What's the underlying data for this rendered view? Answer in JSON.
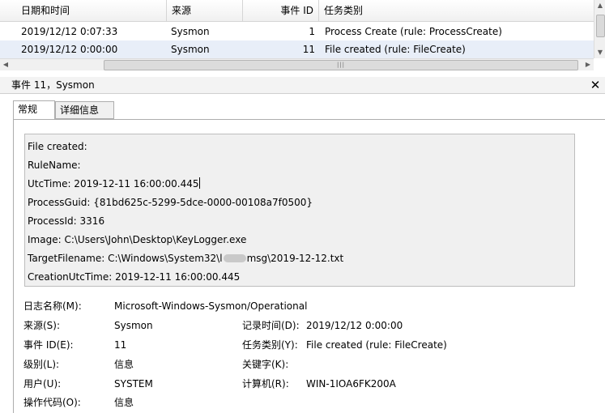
{
  "event_list": {
    "columns": [
      "日期和时间",
      "来源",
      "事件 ID",
      "任务类别"
    ],
    "rows": [
      {
        "date": "2019/12/12 0:07:33",
        "source": "Sysmon",
        "event_id": "1",
        "task": "Process Create (rule: ProcessCreate)"
      },
      {
        "date": "2019/12/12 0:00:00",
        "source": "Sysmon",
        "event_id": "11",
        "task": "File created (rule: FileCreate)"
      }
    ]
  },
  "detail": {
    "title": "事件 11，Sysmon",
    "close_label": "✕",
    "tabs": [
      "常规",
      "详细信息"
    ],
    "message": {
      "line1": "File created:",
      "line2": "RuleName:",
      "line3": "UtcTime: 2019-12-11 16:00:00.445",
      "line4": "ProcessGuid: {81bd625c-5299-5dce-0000-00108a7f0500}",
      "line5": "ProcessId: 3316",
      "line6": "Image: C:\\Users\\John\\Desktop\\KeyLogger.exe",
      "line7_prefix": "TargetFilename: C:\\Windows\\System32\\l",
      "line7_suffix": "msg\\2019-12-12.txt",
      "line8": "CreationUtcTime: 2019-12-11 16:00:00.445"
    },
    "properties": {
      "log_name_label": "日志名称(M):",
      "log_name": "Microsoft-Windows-Sysmon/Operational",
      "source_label": "来源(S):",
      "source": "Sysmon",
      "logged_label": "记录时间(D):",
      "logged": "2019/12/12 0:00:00",
      "event_id_label": "事件 ID(E):",
      "event_id": "11",
      "task_label": "任务类别(Y):",
      "task": "File created (rule: FileCreate)",
      "level_label": "级别(L):",
      "level": "信息",
      "keywords_label": "关键字(K):",
      "user_label": "用户(U):",
      "user": "SYSTEM",
      "computer_label": "计算机(R):",
      "computer": "WIN-1IOA6FK200A",
      "opcode_label": "操作代码(O):",
      "opcode": "信息"
    }
  }
}
